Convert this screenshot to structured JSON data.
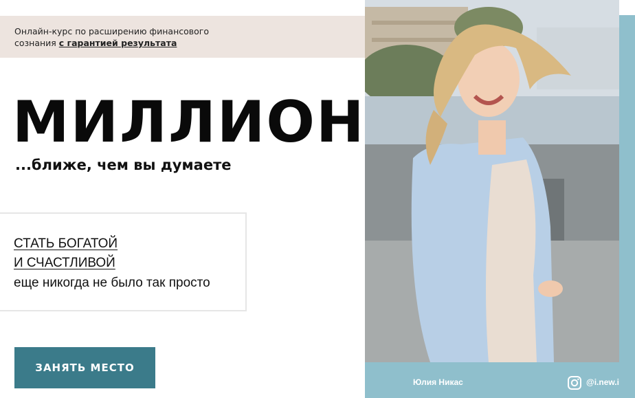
{
  "banner": {
    "line1": "Онлайн-курс по расширению финансового",
    "line2_prefix": "сознания ",
    "line2_emphasis": "с гарантией результата"
  },
  "hero": {
    "title": "МИЛЛИОНЫ",
    "subtitle": "...ближе, чем вы думаете"
  },
  "promo": {
    "line1": "СТАТЬ БОГАТОЙ",
    "line2": "И СЧАСТЛИВОЙ",
    "line3": "еще никогда не было так просто"
  },
  "cta": {
    "label": "ЗАНЯТЬ МЕСТО"
  },
  "footer": {
    "author": "Юлия Никас",
    "instagram_handle": "@i.new.i",
    "icon": "instagram-icon"
  },
  "colors": {
    "accent_teal": "#3b7b8a",
    "strip_teal": "#8fbfcc",
    "banner_bg": "#ede4df"
  }
}
